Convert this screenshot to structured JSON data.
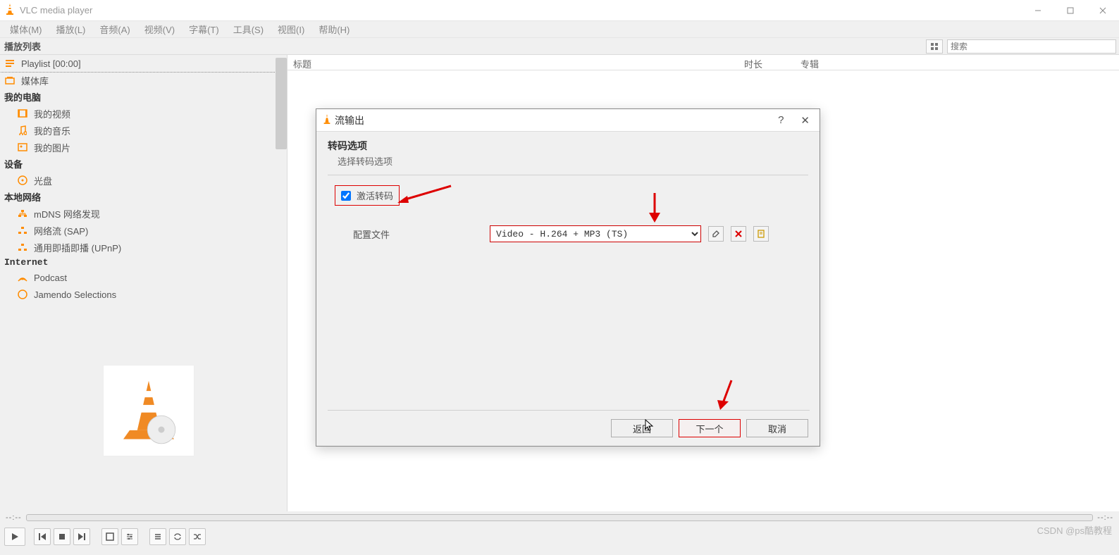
{
  "app_title": "VLC media player",
  "menu": [
    "媒体(M)",
    "播放(L)",
    "音频(A)",
    "视频(V)",
    "字幕(T)",
    "工具(S)",
    "视图(I)",
    "帮助(H)"
  ],
  "playlist_header": "播放列表",
  "search_placeholder": "搜索",
  "sidebar": {
    "playlist": {
      "label": "Playlist",
      "time": "[00:00]"
    },
    "medialib": "媒体库",
    "mycomputer_head": "我的电脑",
    "myvideo": "我的视频",
    "mymusic": "我的音乐",
    "mypics": "我的图片",
    "devices_head": "设备",
    "disc": "光盘",
    "localnet_head": "本地网络",
    "mdns": "mDNS 网络发现",
    "sap": "网络流 (SAP)",
    "upnp": "通用即插即播 (UPnP)",
    "internet_head": "Internet",
    "podcast": "Podcast",
    "jamendo": "Jamendo Selections"
  },
  "columns": {
    "title": "标题",
    "duration": "时长",
    "album": "专辑"
  },
  "seek": {
    "left": "--:--",
    "right": "--:--"
  },
  "dialog": {
    "title": "流输出",
    "section": "转码选项",
    "subsection": "选择转码选项",
    "checkbox_label": "激活转码",
    "profile_label": "配置文件",
    "profile_value": "Video - H.264 + MP3 (TS)",
    "back": "返回",
    "next": "下一个",
    "cancel": "取消"
  },
  "watermark": "CSDN @ps酷教程"
}
